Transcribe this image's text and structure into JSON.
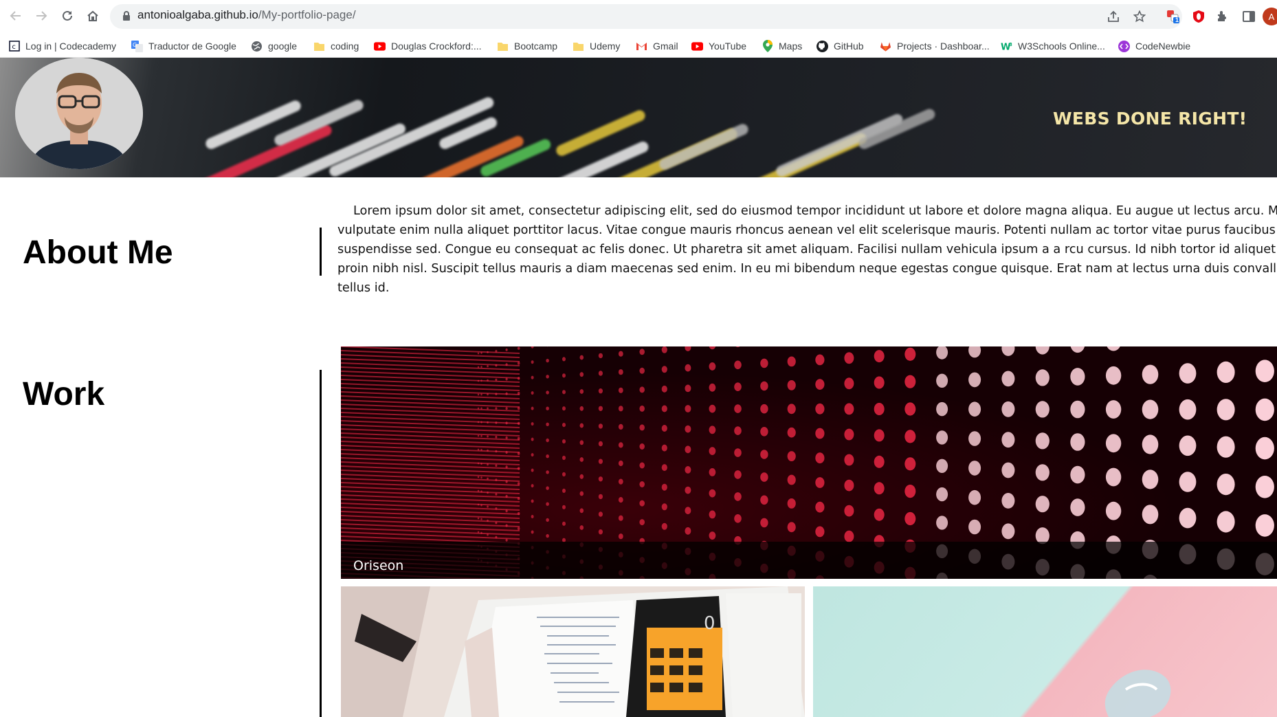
{
  "browser": {
    "url_domain": "antonioalgaba.github.io",
    "url_path": "/My-portfolio-page/",
    "bookmarks": [
      {
        "label": "Log in | Codecademy",
        "icon": "codecademy-icon"
      },
      {
        "label": "Traductor de Google",
        "icon": "google-translate-icon"
      },
      {
        "label": "google",
        "icon": "globe-icon"
      },
      {
        "label": "coding",
        "icon": "folder-icon"
      },
      {
        "label": "Douglas Crockford:...",
        "icon": "youtube-icon"
      },
      {
        "label": "Bootcamp",
        "icon": "folder-icon"
      },
      {
        "label": "Udemy",
        "icon": "folder-icon"
      },
      {
        "label": "Gmail",
        "icon": "gmail-icon"
      },
      {
        "label": "YouTube",
        "icon": "youtube-icon"
      },
      {
        "label": "Maps",
        "icon": "maps-icon"
      },
      {
        "label": "GitHub",
        "icon": "github-icon"
      },
      {
        "label": "Projects · Dashboar...",
        "icon": "gitlab-icon"
      },
      {
        "label": "W3Schools Online...",
        "icon": "w3schools-icon"
      },
      {
        "label": "CodeNewbie",
        "icon": "codenewbie-icon"
      }
    ],
    "extension_badge": "1",
    "profile_initial": "A"
  },
  "hero": {
    "title": "WEBS DONE RIGHT!"
  },
  "about": {
    "heading": "About Me",
    "lines": [
      "Lorem ipsum dolor sit amet, consectetur adipiscing elit, sed do eiusmod tempor incididunt ut labore et dolore magna aliqua. Eu augue ut lectus arcu. Matti",
      "vulputate enim nulla aliquet porttitor lacus. Vitae congue mauris rhoncus aenean vel elit scelerisque mauris. Potenti nullam ac tortor vitae purus faucibus ornare",
      "suspendisse sed. Congue eu consequat ac felis donec. Ut pharetra sit amet aliquam. Facilisi nullam vehicula ipsum a a rcu cursus. Id nibh tortor id aliquet lectu",
      "proin nibh nisl. Suscipit tellus mauris a diam maecenas sed enim. In eu mi bibendum neque egestas congue quisque. Erat nam at lectus urna duis convallis convalli",
      "tellus id."
    ]
  },
  "work": {
    "heading": "Work",
    "main_caption": "Oriseon"
  },
  "colors": {
    "hero_title": "#f5e6a8",
    "led_red": "#ff2a4a"
  }
}
